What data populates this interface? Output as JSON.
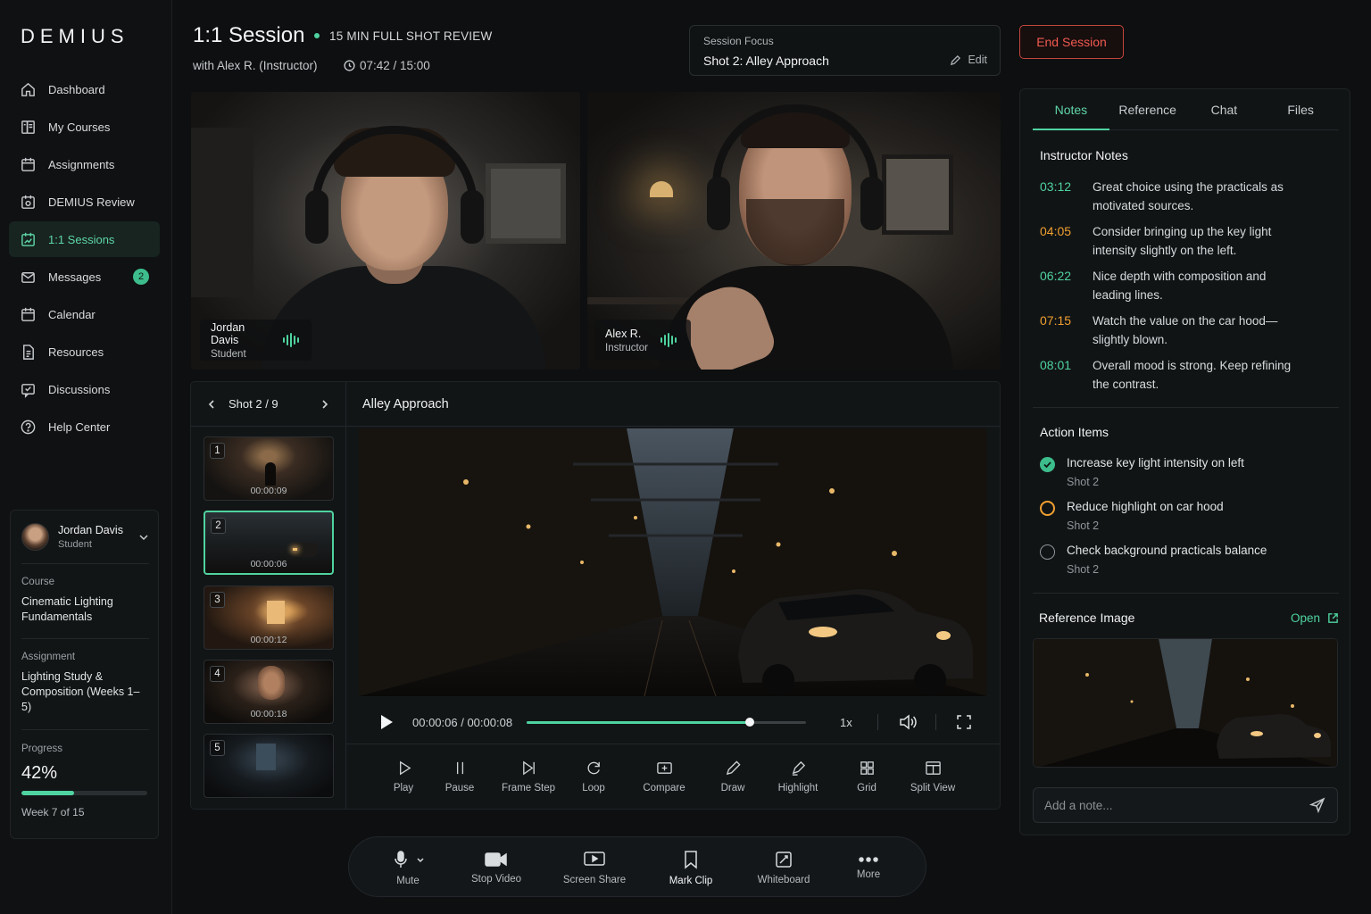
{
  "app": {
    "logo": "DEMIUS"
  },
  "sidebar": {
    "items": [
      {
        "label": "Dashboard",
        "icon": "home-icon"
      },
      {
        "label": "My Courses",
        "icon": "book-icon"
      },
      {
        "label": "Assignments",
        "icon": "calendar-check-icon"
      },
      {
        "label": "DEMIUS Review",
        "icon": "review-icon"
      },
      {
        "label": "1:1 Sessions",
        "icon": "session-icon",
        "active": true
      },
      {
        "label": "Messages",
        "icon": "mail-icon",
        "badge": "2"
      },
      {
        "label": "Calendar",
        "icon": "calendar-icon"
      },
      {
        "label": "Resources",
        "icon": "file-icon"
      },
      {
        "label": "Discussions",
        "icon": "chat-icon"
      },
      {
        "label": "Help Center",
        "icon": "help-icon"
      }
    ],
    "user": {
      "name": "Jordan Davis",
      "role": "Student",
      "course_label": "Course",
      "course": "Cinematic Lighting Fundamentals",
      "assignment_label": "Assignment",
      "assignment": "Lighting Study & Composition (Weeks 1–5)",
      "progress_label": "Progress",
      "progress_text": "42%",
      "progress_value": 0.42,
      "week": "Week 7 of 15"
    }
  },
  "header": {
    "title": "1:1 Session",
    "subtitle": "15 MIN FULL SHOT REVIEW",
    "with": "with Alex R. (Instructor)",
    "timer": "07:42 / 15:00",
    "focus_label": "Session Focus",
    "focus_value": "Shot 2: Alley Approach",
    "edit_label": "Edit",
    "end_label": "End Session"
  },
  "participants": [
    {
      "name": "Jordan Davis",
      "role": "Student"
    },
    {
      "name": "Alex R.",
      "role": "Instructor"
    }
  ],
  "shots": {
    "nav_label": "Shot 2 / 9",
    "title": "Alley Approach",
    "items": [
      {
        "num": "1",
        "time": "00:00:09"
      },
      {
        "num": "2",
        "time": "00:00:06",
        "selected": true
      },
      {
        "num": "3",
        "time": "00:00:12"
      },
      {
        "num": "4",
        "time": "00:00:18"
      },
      {
        "num": "5",
        "time": ""
      }
    ]
  },
  "player": {
    "time": "00:00:06 / 00:00:08",
    "progress": 0.8,
    "speed": "1x"
  },
  "tools": [
    {
      "label": "Play",
      "icon": "play-icon"
    },
    {
      "label": "Pause",
      "icon": "pause-icon"
    },
    {
      "label": "Frame Step",
      "icon": "frame-step-icon"
    },
    {
      "label": "Loop",
      "icon": "loop-icon"
    },
    {
      "label": "Compare",
      "icon": "compare-icon"
    },
    {
      "label": "Draw",
      "icon": "pencil-icon"
    },
    {
      "label": "Highlight",
      "icon": "highlighter-icon"
    },
    {
      "label": "Grid",
      "icon": "grid-icon"
    },
    {
      "label": "Split View",
      "icon": "split-view-icon"
    }
  ],
  "callbar": [
    {
      "label": "Mute",
      "icon": "microphone-icon"
    },
    {
      "label": "Stop Video",
      "icon": "video-camera-icon"
    },
    {
      "label": "Screen Share",
      "icon": "screen-share-icon"
    },
    {
      "label": "Mark Clip",
      "icon": "bookmark-icon"
    },
    {
      "label": "Whiteboard",
      "icon": "whiteboard-icon"
    },
    {
      "label": "More",
      "icon": "more-icon"
    }
  ],
  "rpanel": {
    "tabs": [
      "Notes",
      "Reference",
      "Chat",
      "Files"
    ],
    "notes_title": "Instructor Notes",
    "notes": [
      {
        "time": "03:12",
        "text": "Great choice using the practicals as motivated sources.",
        "color": "#4fd3a0"
      },
      {
        "time": "04:05",
        "text": "Consider bringing up the key light intensity slightly on the left.",
        "color": "#f0a030"
      },
      {
        "time": "06:22",
        "text": "Nice depth with composition and leading lines.",
        "color": "#4fd3a0"
      },
      {
        "time": "07:15",
        "text": "Watch the value on the car hood—slightly blown.",
        "color": "#f0a030"
      },
      {
        "time": "08:01",
        "text": "Overall mood is strong. Keep refining the contrast.",
        "color": "#4fd3a0"
      }
    ],
    "actions_title": "Action Items",
    "actions": [
      {
        "text": "Increase key light intensity on left",
        "shot": "Shot 2",
        "state": "done"
      },
      {
        "text": "Reduce highlight on car hood",
        "shot": "Shot 2",
        "state": "pending"
      },
      {
        "text": "Check background practicals balance",
        "shot": "Shot 2",
        "state": "todo"
      }
    ],
    "ref_title": "Reference Image",
    "ref_open": "Open",
    "note_placeholder": "Add a note..."
  },
  "colors": {
    "accent": "#4fd3a0",
    "warning": "#f0a030",
    "danger": "#f05a4f"
  }
}
